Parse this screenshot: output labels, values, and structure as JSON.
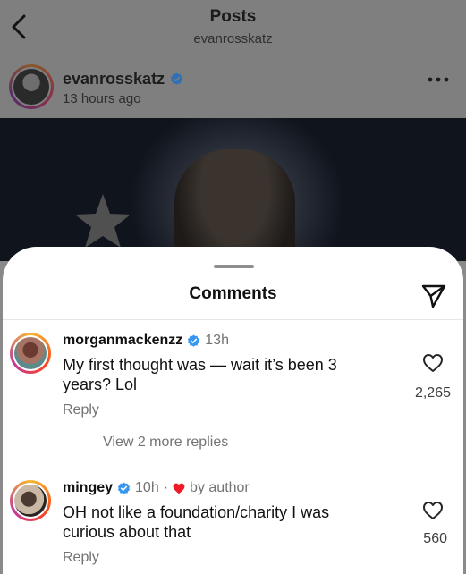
{
  "header": {
    "title": "Posts",
    "subtitle": "evanrosskatz"
  },
  "post": {
    "username": "evanrosskatz",
    "time": "13 hours ago"
  },
  "sheet": {
    "title": "Comments"
  },
  "comments": [
    {
      "username": "morganmackenzz",
      "time": "13h",
      "text": "My first thought was — wait it’s been 3 years? Lol",
      "likes": "2,265",
      "reply_label": "Reply",
      "more_replies": "View 2 more replies"
    },
    {
      "username": "mingey",
      "time": "10h",
      "separator": "·",
      "by_author": "by author",
      "text": "OH not like a foundation/charity I was curious about that",
      "likes": "560",
      "reply_label": "Reply"
    }
  ],
  "colors": {
    "verified": "#3797f0",
    "heart": "#ed1c24"
  }
}
